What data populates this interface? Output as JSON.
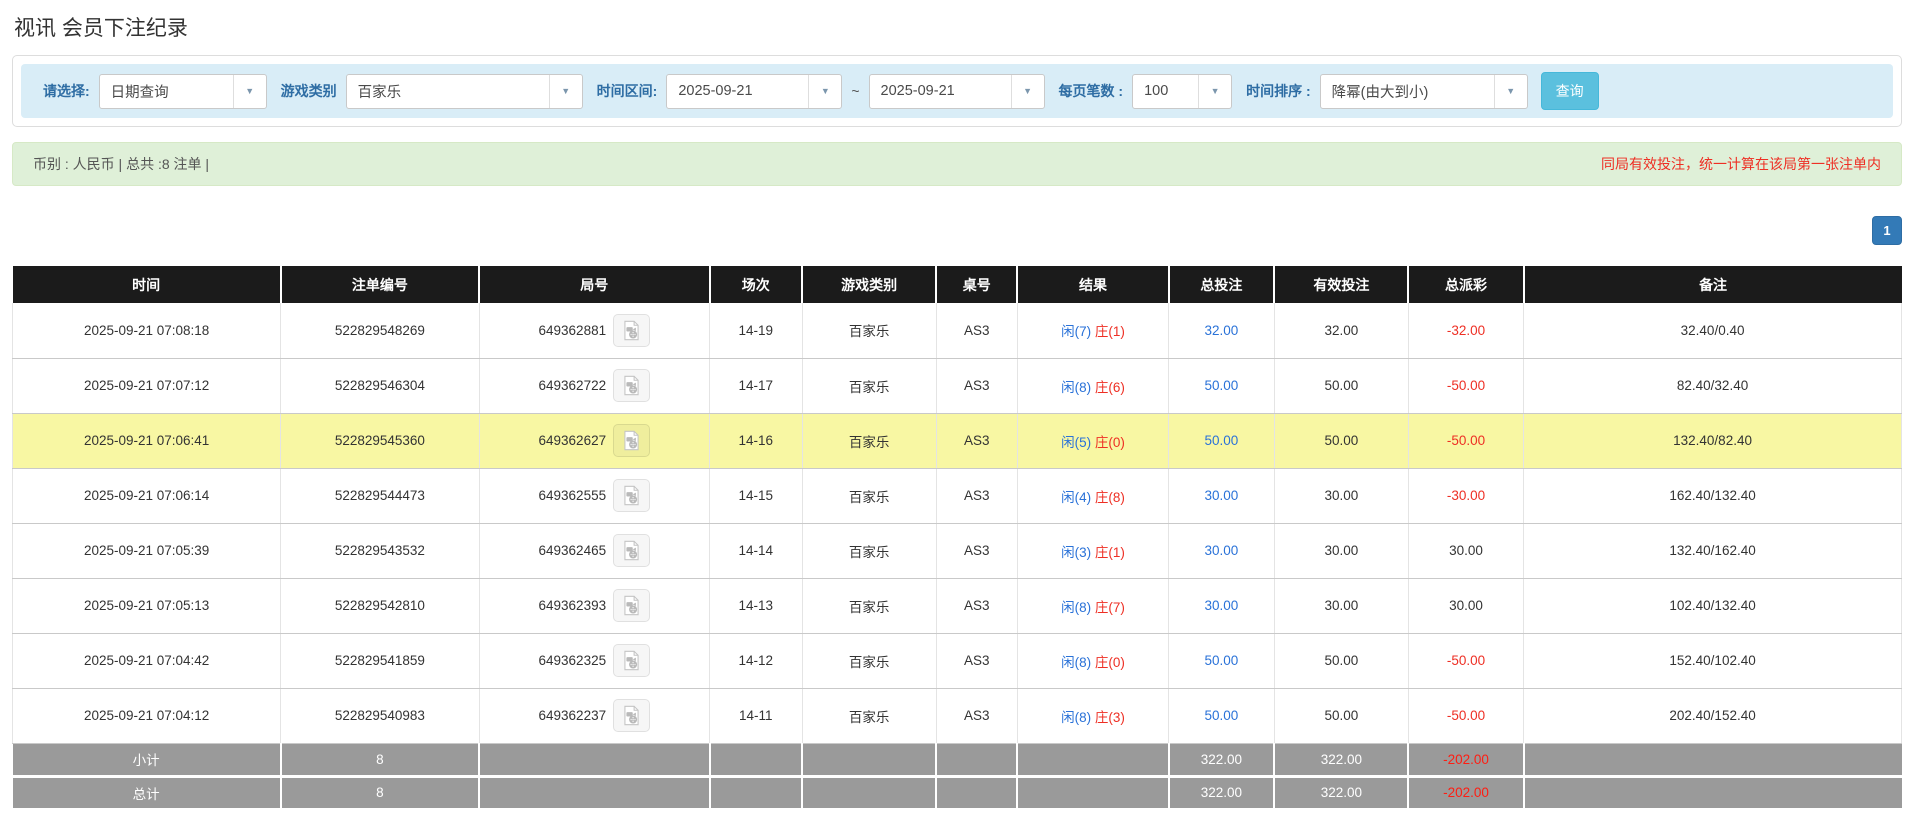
{
  "page": {
    "title": "视讯 会员下注纪录"
  },
  "colors": {
    "accent_blue": "#337ab7",
    "label_blue": "#2e6da4",
    "link_blue": "#2a72d8",
    "red": "#ee2f24",
    "info_bg": "#d9edf7",
    "success_bg": "#dff0d8",
    "header_bg": "#1b1b1b",
    "highlight": "#f8f7a3",
    "footer_grey": "#9a9a9a",
    "search_btn": "#5bc0de"
  },
  "filters": {
    "select_label": "请选择:",
    "select_value": "日期查询",
    "game_type_label": "游戏类别",
    "game_type_value": "百家乐",
    "time_range_label": "时间区间:",
    "date_from": "2025-09-21",
    "tilde": "~",
    "date_to": "2025-09-21",
    "page_size_label": "每页笔数 :",
    "page_size_value": "100",
    "sort_label": "时间排序 :",
    "sort_value": "降幂(由大到小)",
    "search_button": "查询",
    "dropdown_arrow": "▼"
  },
  "summary": {
    "left_text": "币别 : 人民币 | 总共 :8 注单 |",
    "right_note": "同局有效投注，统一计算在该局第一张注单内"
  },
  "pagination": {
    "current_page": "1"
  },
  "icons": {
    "video_icon": "video-file-icon"
  },
  "table": {
    "headers": [
      "时间",
      "注单编号",
      "局号",
      "场次",
      "游戏类别",
      "桌号",
      "结果",
      "总投注",
      "有效投注",
      "总派彩",
      "备注"
    ],
    "col_widths_pct": [
      14.2,
      10.5,
      12.2,
      4.9,
      7.1,
      4.3,
      8.0,
      5.6,
      7.1,
      6.1,
      20.0
    ],
    "rows": [
      {
        "time": "2025-09-21 07:08:18",
        "bet_id": "522829548269",
        "round": "649362881",
        "session": "14-19",
        "game_type": "百家乐",
        "table_no": "AS3",
        "result_player": "闲(7)",
        "result_banker": "庄(1)",
        "total_bet": "32.00",
        "valid_bet": "32.00",
        "payout": "-32.00",
        "note": "32.40/0.40",
        "highlighted": false
      },
      {
        "time": "2025-09-21 07:07:12",
        "bet_id": "522829546304",
        "round": "649362722",
        "session": "14-17",
        "game_type": "百家乐",
        "table_no": "AS3",
        "result_player": "闲(8)",
        "result_banker": "庄(6)",
        "total_bet": "50.00",
        "valid_bet": "50.00",
        "payout": "-50.00",
        "note": "82.40/32.40",
        "highlighted": false
      },
      {
        "time": "2025-09-21 07:06:41",
        "bet_id": "522829545360",
        "round": "649362627",
        "session": "14-16",
        "game_type": "百家乐",
        "table_no": "AS3",
        "result_player": "闲(5)",
        "result_banker": "庄(0)",
        "total_bet": "50.00",
        "valid_bet": "50.00",
        "payout": "-50.00",
        "note": "132.40/82.40",
        "highlighted": true
      },
      {
        "time": "2025-09-21 07:06:14",
        "bet_id": "522829544473",
        "round": "649362555",
        "session": "14-15",
        "game_type": "百家乐",
        "table_no": "AS3",
        "result_player": "闲(4)",
        "result_banker": "庄(8)",
        "total_bet": "30.00",
        "valid_bet": "30.00",
        "payout": "-30.00",
        "note": "162.40/132.40",
        "highlighted": false
      },
      {
        "time": "2025-09-21 07:05:39",
        "bet_id": "522829543532",
        "round": "649362465",
        "session": "14-14",
        "game_type": "百家乐",
        "table_no": "AS3",
        "result_player": "闲(3)",
        "result_banker": "庄(1)",
        "total_bet": "30.00",
        "valid_bet": "30.00",
        "payout": "30.00",
        "note": "132.40/162.40",
        "highlighted": false
      },
      {
        "time": "2025-09-21 07:05:13",
        "bet_id": "522829542810",
        "round": "649362393",
        "session": "14-13",
        "game_type": "百家乐",
        "table_no": "AS3",
        "result_player": "闲(8)",
        "result_banker": "庄(7)",
        "total_bet": "30.00",
        "valid_bet": "30.00",
        "payout": "30.00",
        "note": "102.40/132.40",
        "highlighted": false
      },
      {
        "time": "2025-09-21 07:04:42",
        "bet_id": "522829541859",
        "round": "649362325",
        "session": "14-12",
        "game_type": "百家乐",
        "table_no": "AS3",
        "result_player": "闲(8)",
        "result_banker": "庄(0)",
        "total_bet": "50.00",
        "valid_bet": "50.00",
        "payout": "-50.00",
        "note": "152.40/102.40",
        "highlighted": false
      },
      {
        "time": "2025-09-21 07:04:12",
        "bet_id": "522829540983",
        "round": "649362237",
        "session": "14-11",
        "game_type": "百家乐",
        "table_no": "AS3",
        "result_player": "闲(8)",
        "result_banker": "庄(3)",
        "total_bet": "50.00",
        "valid_bet": "50.00",
        "payout": "-50.00",
        "note": "202.40/152.40",
        "highlighted": false
      }
    ],
    "subtotal": {
      "label": "小计",
      "count": "8",
      "total_bet": "322.00",
      "valid_bet": "322.00",
      "payout": "-202.00"
    },
    "total": {
      "label": "总计",
      "count": "8",
      "total_bet": "322.00",
      "valid_bet": "322.00",
      "payout": "-202.00"
    }
  }
}
